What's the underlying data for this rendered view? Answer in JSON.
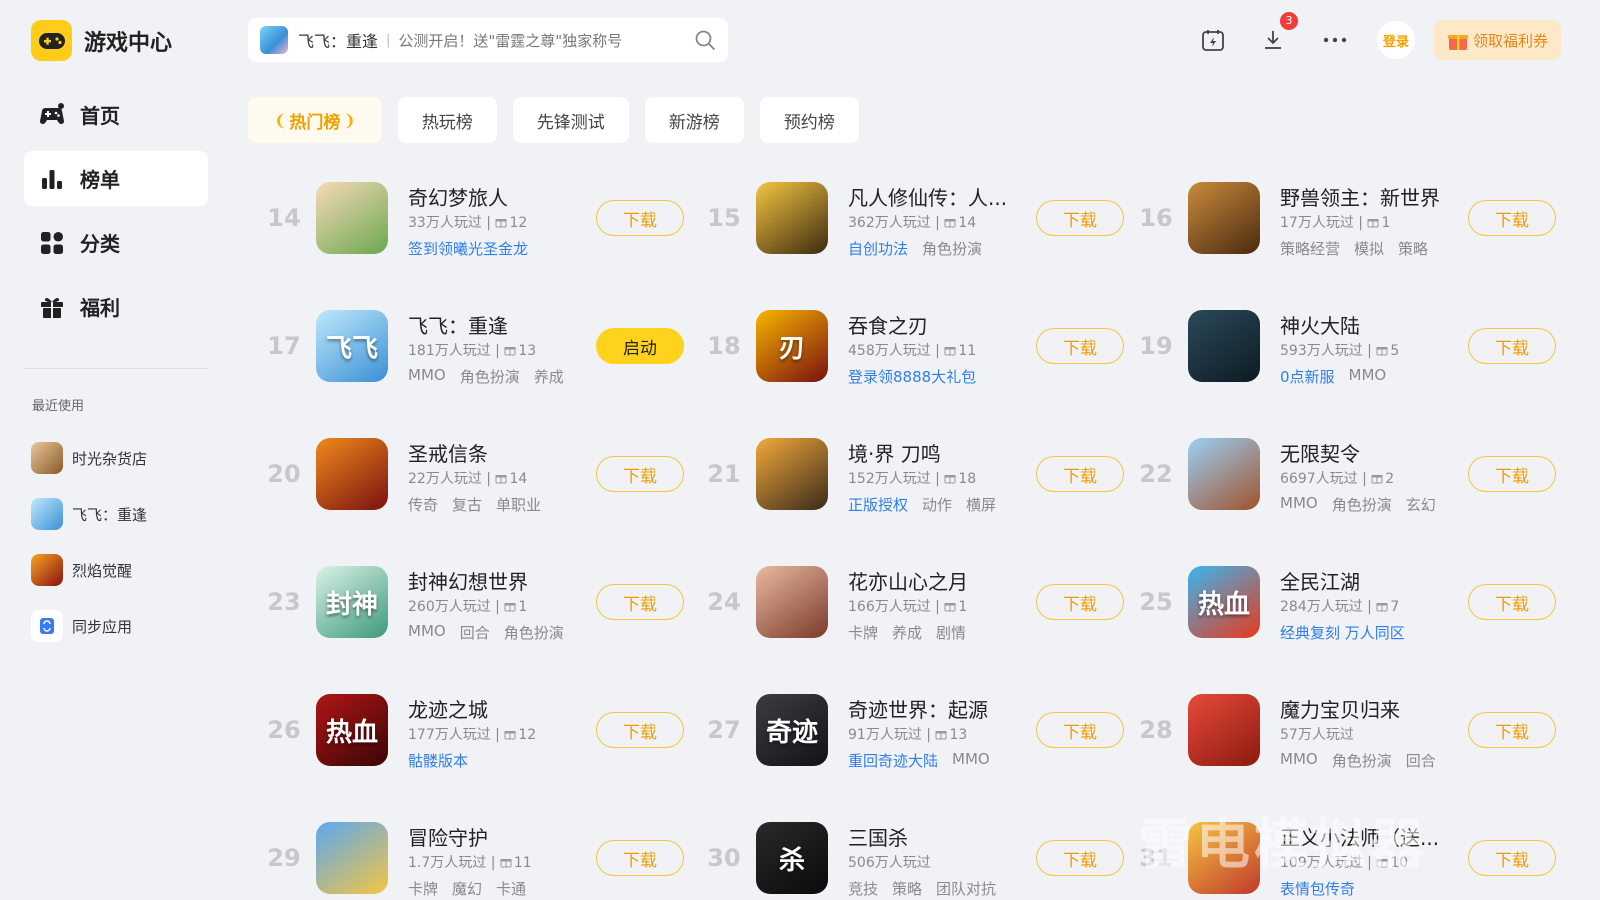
{
  "brand": {
    "title": "游戏中心"
  },
  "sidebar": {
    "nav": [
      {
        "label": "首页",
        "icon": "gamepad-icon"
      },
      {
        "label": "榜单",
        "icon": "bar-chart-icon"
      },
      {
        "label": "分类",
        "icon": "grid-icon"
      },
      {
        "label": "福利",
        "icon": "gift-icon"
      }
    ],
    "active_index": 1,
    "recent_title": "最近使用",
    "recent": [
      {
        "label": "时光杂货店",
        "color": "#c89a6a"
      },
      {
        "label": "飞飞：重逢",
        "color": "#5fb8f0"
      },
      {
        "label": "烈焰觉醒",
        "color": "#c0392b"
      },
      {
        "label": "同步应用",
        "color": "#3a7bf0"
      }
    ]
  },
  "search": {
    "game_name": "飞飞：重逢",
    "separator": "|",
    "subtitle": "公测开启！送\"雷霆之尊\"独家称号"
  },
  "header": {
    "download_badge": "3",
    "login_label": "登录",
    "coupon_label": "领取福利券"
  },
  "tabs": [
    {
      "label": "热门榜",
      "active": true
    },
    {
      "label": "热玩榜",
      "active": false
    },
    {
      "label": "先锋测试",
      "active": false
    },
    {
      "label": "新游榜",
      "active": false
    },
    {
      "label": "预约榜",
      "active": false
    }
  ],
  "games": [
    {
      "rank": "14",
      "name": "奇幻梦旅人",
      "players": "33万人玩过",
      "gifts": "12",
      "tags": [
        {
          "t": "签到领曦光圣金龙",
          "hl": true
        }
      ],
      "action": "下载",
      "icon_text": "",
      "c1": "#f7d9b8",
      "c2": "#6aa84f"
    },
    {
      "rank": "15",
      "name": "凡人修仙传：人...",
      "players": "362万人玩过",
      "gifts": "14",
      "tags": [
        {
          "t": "自创功法",
          "hl": true
        },
        {
          "t": "角色扮演",
          "hl": false
        }
      ],
      "action": "下载",
      "icon_text": "",
      "c1": "#f5c542",
      "c2": "#3b2a10"
    },
    {
      "rank": "16",
      "name": "野兽领主：新世界",
      "players": "17万人玩过",
      "gifts": "1",
      "tags": [
        {
          "t": "策略经营",
          "hl": false
        },
        {
          "t": "模拟",
          "hl": false
        },
        {
          "t": "策略",
          "hl": false
        }
      ],
      "action": "下载",
      "icon_text": "",
      "c1": "#c98a3c",
      "c2": "#4a2a10"
    },
    {
      "rank": "17",
      "name": "飞飞：重逢",
      "players": "181万人玩过",
      "gifts": "13",
      "tags": [
        {
          "t": "MMO",
          "hl": false
        },
        {
          "t": "角色扮演",
          "hl": false
        },
        {
          "t": "养成",
          "hl": false
        }
      ],
      "action": "启动",
      "icon_text": "飞飞",
      "c1": "#bfe9fb",
      "c2": "#3a8fd6"
    },
    {
      "rank": "18",
      "name": "吞食之刃",
      "players": "458万人玩过",
      "gifts": "11",
      "tags": [
        {
          "t": "登录领8888大礼包",
          "hl": true
        }
      ],
      "action": "下载",
      "icon_text": "刃",
      "c1": "#f7b500",
      "c2": "#7a1010"
    },
    {
      "rank": "19",
      "name": "神火大陆",
      "players": "593万人玩过",
      "gifts": "5",
      "tags": [
        {
          "t": "0点新服",
          "hl": true
        },
        {
          "t": "MMO",
          "hl": false
        }
      ],
      "action": "下载",
      "icon_text": "",
      "c1": "#2b4a5a",
      "c2": "#0d1a22"
    },
    {
      "rank": "20",
      "name": "圣戒信条",
      "players": "22万人玩过",
      "gifts": "14",
      "tags": [
        {
          "t": "传奇",
          "hl": false
        },
        {
          "t": "复古",
          "hl": false
        },
        {
          "t": "单职业",
          "hl": false
        }
      ],
      "action": "下载",
      "icon_text": "",
      "c1": "#f08a1c",
      "c2": "#7a1010"
    },
    {
      "rank": "21",
      "name": "境·界 刀鸣",
      "players": "152万人玩过",
      "gifts": "18",
      "tags": [
        {
          "t": "正版授权",
          "hl": true
        },
        {
          "t": "动作",
          "hl": false
        },
        {
          "t": "横屏",
          "hl": false
        }
      ],
      "action": "下载",
      "icon_text": "",
      "c1": "#f2a93b",
      "c2": "#3a2a1a"
    },
    {
      "rank": "22",
      "name": "无限契令",
      "players": "6697人玩过",
      "gifts": "2",
      "tags": [
        {
          "t": "MMO",
          "hl": false
        },
        {
          "t": "角色扮演",
          "hl": false
        },
        {
          "t": "玄幻",
          "hl": false
        }
      ],
      "action": "下载",
      "icon_text": "",
      "c1": "#9ad0f5",
      "c2": "#a0522d"
    },
    {
      "rank": "23",
      "name": "封神幻想世界",
      "players": "260万人玩过",
      "gifts": "1",
      "tags": [
        {
          "t": "MMO",
          "hl": false
        },
        {
          "t": "回合",
          "hl": false
        },
        {
          "t": "角色扮演",
          "hl": false
        }
      ],
      "action": "下载",
      "icon_text": "封神",
      "c1": "#d9f2e6",
      "c2": "#3e9a7a"
    },
    {
      "rank": "24",
      "name": "花亦山心之月",
      "players": "166万人玩过",
      "gifts": "1",
      "tags": [
        {
          "t": "卡牌",
          "hl": false
        },
        {
          "t": "养成",
          "hl": false
        },
        {
          "t": "剧情",
          "hl": false
        }
      ],
      "action": "下载",
      "icon_text": "",
      "c1": "#e8b9a0",
      "c2": "#7a3a2a"
    },
    {
      "rank": "25",
      "name": "全民江湖",
      "players": "284万人玩过",
      "gifts": "7",
      "tags": [
        {
          "t": "经典复刻 万人同区",
          "hl": true
        }
      ],
      "action": "下载",
      "icon_text": "热血",
      "c1": "#39b6f0",
      "c2": "#e8391b"
    },
    {
      "rank": "26",
      "name": "龙迹之城",
      "players": "177万人玩过",
      "gifts": "12",
      "tags": [
        {
          "t": "骷髅版本",
          "hl": true
        }
      ],
      "action": "下载",
      "icon_text": "热血",
      "c1": "#b01616",
      "c2": "#3a0505"
    },
    {
      "rank": "27",
      "name": "奇迹世界：起源",
      "players": "91万人玩过",
      "gifts": "13",
      "tags": [
        {
          "t": "重回奇迹大陆",
          "hl": true
        },
        {
          "t": "MMO",
          "hl": false
        }
      ],
      "action": "下载",
      "icon_text": "奇迹",
      "c1": "#3a3d42",
      "c2": "#121315"
    },
    {
      "rank": "28",
      "name": "魔力宝贝归来",
      "players": "57万人玩过",
      "gifts": "",
      "tags": [
        {
          "t": "MMO",
          "hl": false
        },
        {
          "t": "角色扮演",
          "hl": false
        },
        {
          "t": "回合",
          "hl": false
        }
      ],
      "action": "下载",
      "icon_text": "",
      "c1": "#e84a3a",
      "c2": "#8a1a10"
    },
    {
      "rank": "29",
      "name": "冒险守护",
      "players": "1.7万人玩过",
      "gifts": "11",
      "tags": [
        {
          "t": "卡牌",
          "hl": false
        },
        {
          "t": "魔幻",
          "hl": false
        },
        {
          "t": "卡通",
          "hl": false
        }
      ],
      "action": "下载",
      "icon_text": "",
      "c1": "#5aa8f0",
      "c2": "#f5c542"
    },
    {
      "rank": "30",
      "name": "三国杀",
      "players": "506万人玩过",
      "gifts": "",
      "tags": [
        {
          "t": "竞技",
          "hl": false
        },
        {
          "t": "策略",
          "hl": false
        },
        {
          "t": "团队对抗",
          "hl": false
        }
      ],
      "action": "下载",
      "icon_text": "杀",
      "c1": "#2a2a2a",
      "c2": "#0a0a0a"
    },
    {
      "rank": "31",
      "name": "正义小法师（送...",
      "players": "109万人玩过",
      "gifts": "10",
      "tags": [
        {
          "t": "表情包传奇",
          "hl": true
        }
      ],
      "action": "下载",
      "icon_text": "",
      "c1": "#f5c542",
      "c2": "#c0392b"
    }
  ],
  "watermark": "雷电模拟器"
}
